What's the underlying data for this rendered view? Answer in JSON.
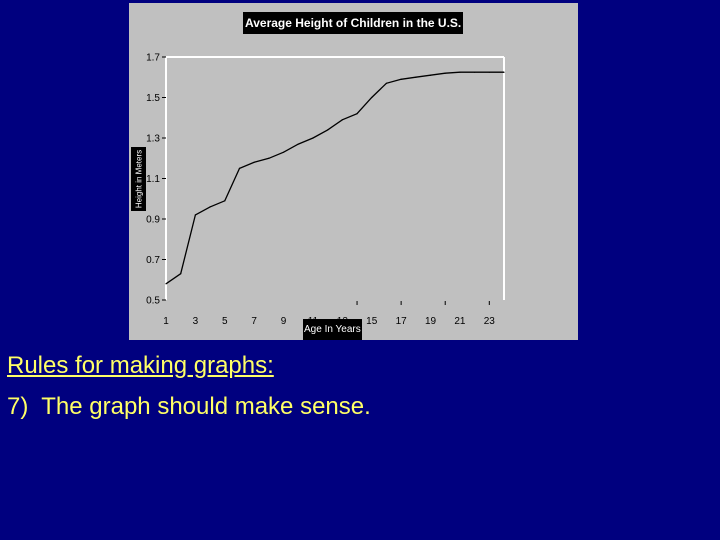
{
  "slide": {
    "background_color": "#00007f",
    "text_color": "#ffff66",
    "heading": "Rules for making graphs:",
    "rule": "7)  The graph should make sense."
  },
  "chart_data": {
    "type": "line",
    "title": "Average Height of Children in the U.S.",
    "xlabel": "Age In Years",
    "ylabel": "Height in Meters",
    "x": [
      1,
      2,
      3,
      4,
      5,
      6,
      7,
      8,
      9,
      10,
      11,
      12,
      13,
      14,
      15,
      16,
      17,
      18,
      19,
      20,
      21,
      22,
      23,
      24
    ],
    "series": [
      {
        "name": "Average Height",
        "values": [
          0.58,
          0.63,
          0.92,
          0.96,
          0.99,
          1.15,
          1.18,
          1.2,
          1.23,
          1.27,
          1.3,
          1.34,
          1.39,
          1.42,
          1.5,
          1.57,
          1.59,
          1.6,
          1.61,
          1.62,
          1.625,
          1.625,
          1.625,
          1.625
        ]
      }
    ],
    "xticks": [
      "1",
      "3",
      "5",
      "7",
      "9",
      "11",
      "13",
      "15",
      "17",
      "19",
      "21",
      "23"
    ],
    "yticks": [
      "0.5",
      "0.7",
      "0.9",
      "1.1",
      "1.3",
      "1.5",
      "1.7"
    ],
    "xlim": [
      1,
      24
    ],
    "ylim": [
      0.5,
      1.7
    ],
    "grid": false,
    "legend": "none",
    "panel_color": "#c0c0c0",
    "line_color": "#000000",
    "frame_color": "#ffffff"
  }
}
